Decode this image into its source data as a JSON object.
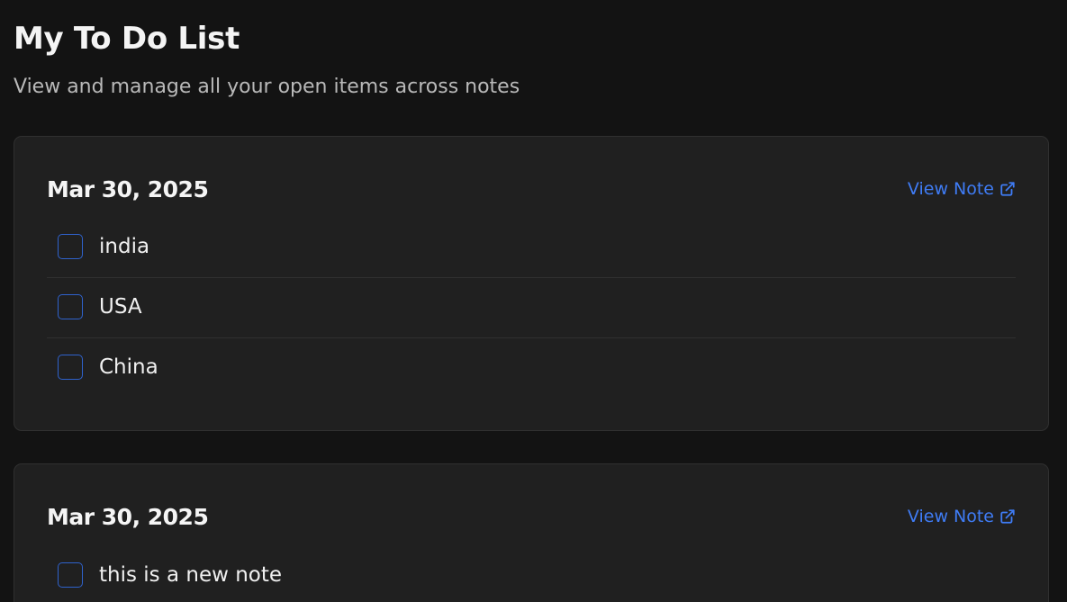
{
  "header": {
    "title": "My To Do List",
    "subtitle": "View and manage all your open items across notes"
  },
  "notes": [
    {
      "date": "Mar 30, 2025",
      "view_link": "View Note",
      "items": [
        {
          "text": "india",
          "checked": false
        },
        {
          "text": "USA",
          "checked": false
        },
        {
          "text": "China",
          "checked": false
        }
      ]
    },
    {
      "date": "Mar 30, 2025",
      "view_link": "View Note",
      "items": [
        {
          "text": "this is a new note",
          "checked": false
        }
      ]
    }
  ],
  "icons": {
    "external_link": "external-link-icon"
  },
  "colors": {
    "background": "#131313",
    "card": "#202020",
    "accent": "#3f7cf5",
    "checkbox_border": "#2f62cc"
  }
}
